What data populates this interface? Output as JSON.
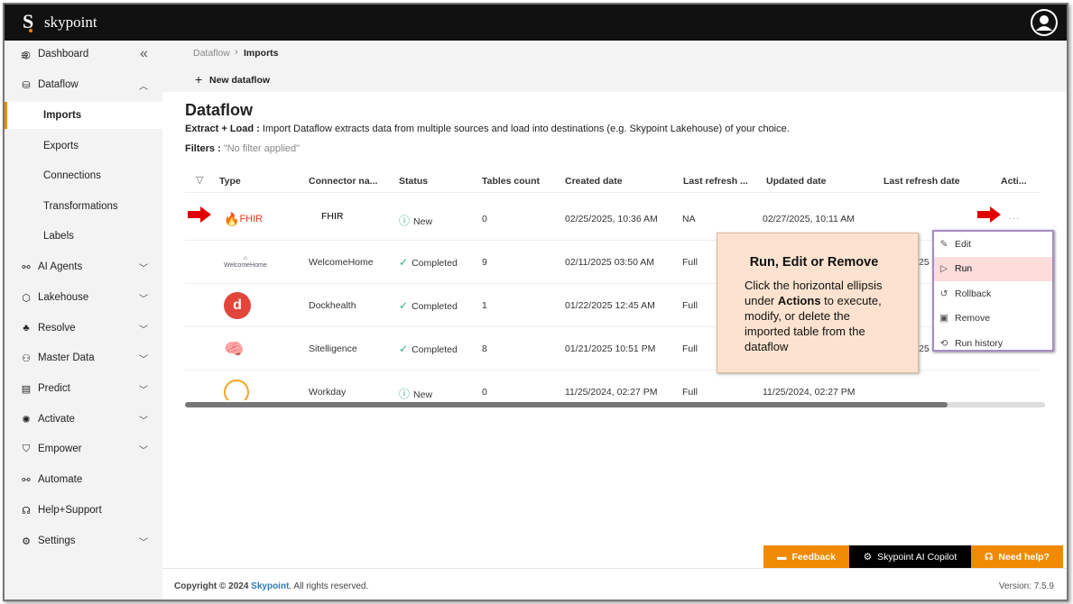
{
  "app": {
    "logo_letter": "S",
    "name": "skypoint"
  },
  "breadcrumb": {
    "parent": "Dataflow",
    "current": "Imports"
  },
  "toolbar": {
    "new_dataflow": "New dataflow"
  },
  "page": {
    "title": "Dataflow",
    "desc_label": "Extract + Load :",
    "desc_text": "Import Dataflow extracts data from multiple sources and load into destinations (e.g. Skypoint Lakehouse) of your choice.",
    "filters_label": "Filters :",
    "filters_value": "\"No filter applied\""
  },
  "sidebar": {
    "items": [
      {
        "label": "Dashboard",
        "icon": "gauge-icon",
        "chev": ""
      },
      {
        "label": "Dataflow",
        "icon": "database-icon",
        "chev": "up"
      },
      {
        "label": "Imports",
        "sub": true,
        "active": true
      },
      {
        "label": "Exports",
        "sub": true
      },
      {
        "label": "Connections",
        "sub": true
      },
      {
        "label": "Transformations",
        "sub": true
      },
      {
        "label": "Labels",
        "sub": true
      },
      {
        "label": "AI Agents",
        "icon": "agents-icon",
        "chev": "down"
      },
      {
        "label": "Lakehouse",
        "icon": "cube-icon",
        "chev": "down"
      },
      {
        "label": "Resolve",
        "icon": "hierarchy-icon",
        "chev": "down"
      },
      {
        "label": "Master Data",
        "icon": "people-icon",
        "chev": "down"
      },
      {
        "label": "Predict",
        "icon": "predict-icon",
        "chev": "down"
      },
      {
        "label": "Activate",
        "icon": "bulb-icon",
        "chev": "down"
      },
      {
        "label": "Empower",
        "icon": "shield-icon",
        "chev": "down"
      },
      {
        "label": "Automate",
        "icon": "flow-icon",
        "chev": ""
      },
      {
        "label": "Help+Support",
        "icon": "headset-icon",
        "chev": ""
      },
      {
        "label": "Settings",
        "icon": "gear-icon",
        "chev": "down"
      }
    ]
  },
  "table": {
    "columns": [
      "Type",
      "Connector na...",
      "Status",
      "Tables count",
      "Created date",
      "Last refresh ...",
      "Updated date",
      "Last refresh date",
      "Acti..."
    ],
    "rows": [
      {
        "logo": "FHIR",
        "name": "FHIR",
        "status": "New",
        "tables": "0",
        "created": "02/25/2025, 10:36 AM",
        "last_refresh_type": "NA",
        "updated": "02/27/2025, 10:11 AM",
        "last_refresh_date": "",
        "actions": "···"
      },
      {
        "logo": "WelcomeHome",
        "name": "WelcomeHome",
        "status": "Completed",
        "tables": "9",
        "created": "02/11/2025 03:50 AM",
        "last_refresh_type": "Full",
        "updated": "",
        "last_refresh_date": "25",
        "actions": ""
      },
      {
        "logo": "Dockhealth",
        "name": "Dockhealth",
        "status": "Completed",
        "tables": "1",
        "created": "01/22/2025 12:45 AM",
        "last_refresh_type": "Full",
        "updated": "",
        "last_refresh_date": "",
        "actions": ""
      },
      {
        "logo": "Sitelligence",
        "name": "Sitelligence",
        "status": "Completed",
        "tables": "8",
        "created": "01/21/2025 10:51 PM",
        "last_refresh_type": "Full",
        "updated": "",
        "last_refresh_date": "25",
        "actions": ""
      },
      {
        "logo": "Workday",
        "name": "Workday",
        "status": "New",
        "tables": "0",
        "created": "11/25/2024, 02:27 PM",
        "last_refresh_type": "Full",
        "updated": "11/25/2024, 02:27 PM",
        "last_refresh_date": "",
        "actions": ""
      }
    ]
  },
  "action_menu": {
    "items": [
      "Edit",
      "Run",
      "Rollback",
      "Remove",
      "Run history"
    ],
    "highlighted": "Run"
  },
  "callout": {
    "title": "Run, Edit or Remove",
    "text_1": "Click the horizontal ellipsis under ",
    "text_bold": "Actions",
    "text_2": " to execute, modify, or delete the imported table from the dataflow"
  },
  "bottom_buttons": {
    "feedback": "Feedback",
    "copilot": "Skypoint AI Copilot",
    "help": "Need help?"
  },
  "footer": {
    "copyright": "Copyright © 2024 ",
    "brand": "Skypoint",
    "rights": ". All rights reserved.",
    "version": "Version: 7.5.9"
  },
  "colors": {
    "accent": "#f08a00",
    "topbar": "#111111",
    "arrow": "#e00000",
    "callout": "#fde3cf",
    "menu_border": "#a58cc4",
    "status_ok": "#2eab7d"
  }
}
